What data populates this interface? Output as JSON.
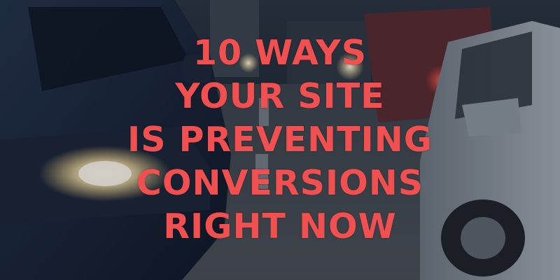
{
  "image": {
    "subject": "traffic jam with cars",
    "colors": {
      "headline": "#f25050",
      "headlights": "#fff3cc"
    }
  },
  "headline": {
    "lines": [
      "10 WAYS",
      "YOUR SITE",
      "IS PREVENTING",
      "CONVERSIONS",
      "RIGHT NOW"
    ]
  }
}
